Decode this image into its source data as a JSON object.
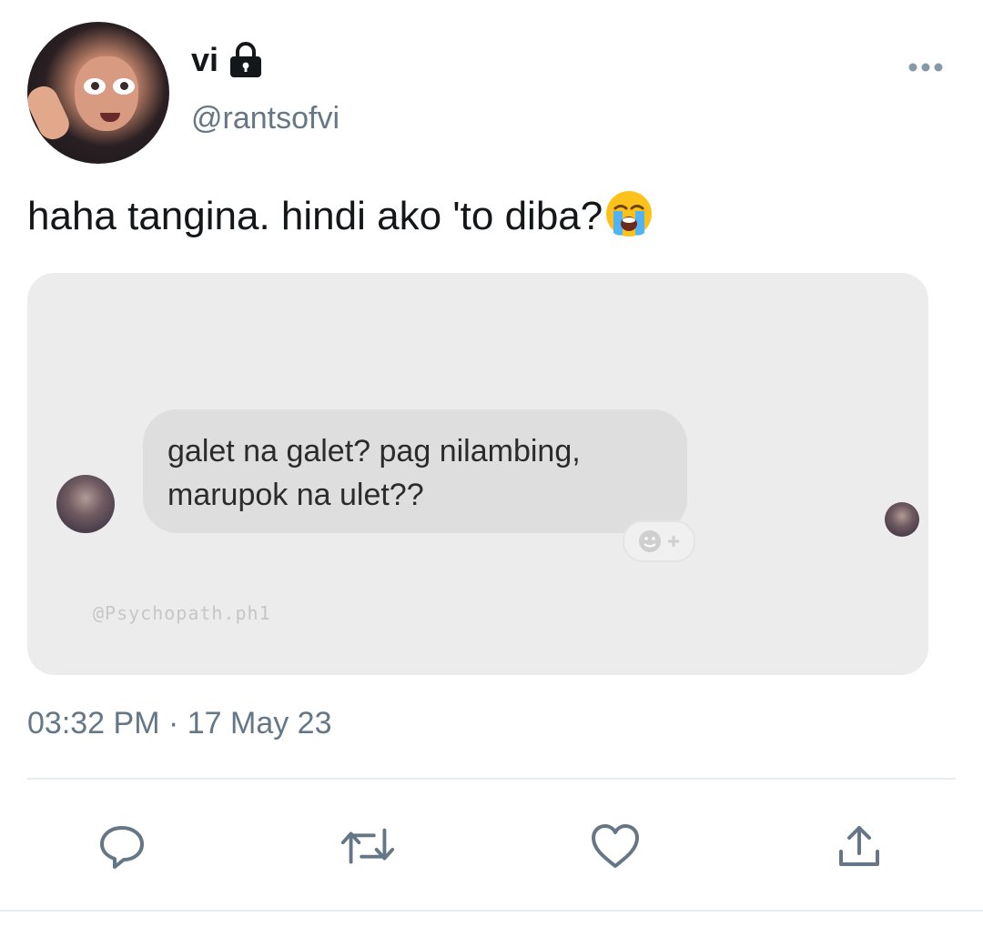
{
  "user": {
    "display_name": "vi",
    "handle": "@rantsofvi",
    "protected_icon": "lock-icon",
    "avatar": "avatar"
  },
  "tweet": {
    "text": "haha tangina. hindi ako 'to diba?",
    "emoji": "loudly-crying-face-icon"
  },
  "media": {
    "message": "galet na galet? pag nilambing,\nmarupok na ulet??",
    "watermark": "@Psychopath.ph1",
    "react_icon": "add-reaction-icon"
  },
  "meta": {
    "timestamp": "03:32 PM · 17 May 23"
  },
  "actions": [
    {
      "name": "reply",
      "icon": "reply-icon"
    },
    {
      "name": "retweet",
      "icon": "retweet-icon"
    },
    {
      "name": "like",
      "icon": "heart-icon"
    },
    {
      "name": "share",
      "icon": "share-icon"
    }
  ],
  "colors": {
    "text_primary": "#14171a",
    "text_secondary": "#657786",
    "icon": "#657786",
    "divider": "#e6ecf0",
    "media_bg": "#ececec",
    "bubble_bg": "#dedede"
  }
}
